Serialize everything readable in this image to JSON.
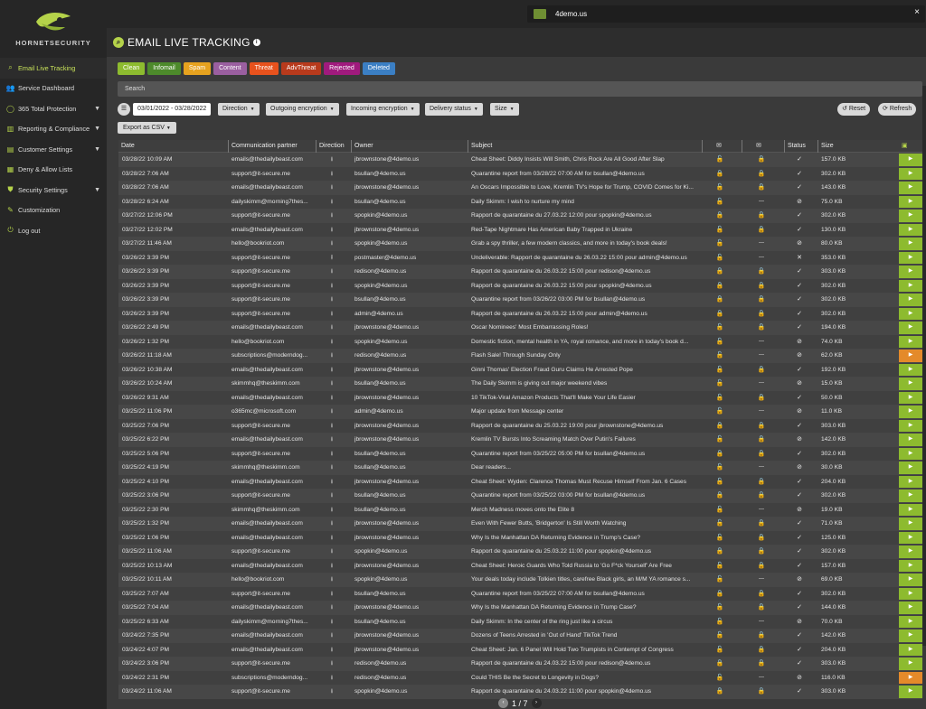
{
  "brand": {
    "name": "HORNETSECURITY"
  },
  "sidebar": {
    "items": [
      {
        "label": "Email Live Tracking",
        "icon": "magnifier-icon",
        "active": true,
        "chevron": false
      },
      {
        "label": "Service Dashboard",
        "icon": "users-icon",
        "active": false,
        "chevron": false
      },
      {
        "label": "365 Total Protection",
        "icon": "circle-icon",
        "active": false,
        "chevron": true
      },
      {
        "label": "Reporting & Compliance",
        "icon": "chart-icon",
        "active": false,
        "chevron": true
      },
      {
        "label": "Customer Settings",
        "icon": "card-icon",
        "active": false,
        "chevron": true
      },
      {
        "label": "Deny & Allow Lists",
        "icon": "list-icon",
        "active": false,
        "chevron": false
      },
      {
        "label": "Security Settings",
        "icon": "shield-icon",
        "active": false,
        "chevron": true
      },
      {
        "label": "Customization",
        "icon": "brush-icon",
        "active": false,
        "chevron": false
      },
      {
        "label": "Log out",
        "icon": "power-icon",
        "active": false,
        "chevron": false
      }
    ]
  },
  "topbar": {
    "tenant": "4demo.us",
    "close_label": "×"
  },
  "header": {
    "title": "EMAIL LIVE TRACKING",
    "info": "i"
  },
  "chips": [
    {
      "label": "Clean",
      "color": "#8dbb2f"
    },
    {
      "label": "Infomail",
      "color": "#4d8a2b"
    },
    {
      "label": "Spam",
      "color": "#e6a21f"
    },
    {
      "label": "Content",
      "color": "#9a5fa0"
    },
    {
      "label": "Threat",
      "color": "#e8521d"
    },
    {
      "label": "AdvThreat",
      "color": "#b83a1c"
    },
    {
      "label": "Rejected",
      "color": "#a01a7d"
    },
    {
      "label": "Deleted",
      "color": "#3b7fc4"
    }
  ],
  "search": {
    "placeholder": "Search"
  },
  "filters": {
    "date_range": "03/01/2022 - 03/28/2022",
    "direction": "Direction",
    "outgoing": "Outgoing encryption",
    "incoming": "Incoming encryption",
    "delivery": "Delivery status",
    "size": "Size",
    "reset": "Reset",
    "refresh": "Refresh",
    "export": "Export as CSV"
  },
  "table": {
    "columns": [
      "Date",
      "Communication partner",
      "Direction",
      "Owner",
      "Subject",
      "",
      "",
      "Status",
      "Size"
    ],
    "rows": [
      [
        "03/28/22 10:09 AM",
        "emails@thedailybeast.com",
        "in",
        "jbrownstone@4demo.us",
        "Cheat Sheet: Diddy Insists Will Smith, Chris Rock Are All Good After Slap",
        "open",
        "lock",
        "check",
        "157.0 KB",
        "green"
      ],
      [
        "03/28/22 7:06 AM",
        "support@it-secure.me",
        "in",
        "bsullan@4demo.us",
        "Quarantine report from 03/28/22 07:00 AM for bsullan@4demo.us",
        "lock",
        "lock",
        "check",
        "302.0 KB",
        "green"
      ],
      [
        "03/28/22 7:06 AM",
        "emails@thedailybeast.com",
        "in",
        "jbrownstone@4demo.us",
        "An Oscars Impossible to Love, Kremlin TV's Hope for Trump, COVID Comes for Ki...",
        "open",
        "lock",
        "check",
        "143.0 KB",
        "green"
      ],
      [
        "03/28/22 6:24 AM",
        "dailyskimm@morning7thes...",
        "in",
        "bsullan@4demo.us",
        "Daily Skimm: I wish to nurture my mind",
        "open",
        "dash",
        "ban",
        "75.0 KB",
        "green"
      ],
      [
        "03/27/22 12:06 PM",
        "support@it-secure.me",
        "in",
        "spopkin@4demo.us",
        "Rapport de quarantaine du 27.03.22 12:00 pour spopkin@4demo.us",
        "lock",
        "lock",
        "check",
        "302.0 KB",
        "green"
      ],
      [
        "03/27/22 12:02 PM",
        "emails@thedailybeast.com",
        "in",
        "jbrownstone@4demo.us",
        "Red-Tape Nightmare Has American Baby Trapped in Ukraine",
        "open",
        "lock",
        "check",
        "130.0 KB",
        "green"
      ],
      [
        "03/27/22 11:46 AM",
        "hello@bookriot.com",
        "in",
        "spopkin@4demo.us",
        "Grab a spy thriller, a few modern classics, and more in today's book deals!",
        "open",
        "dash",
        "ban",
        "80.0 KB",
        "green"
      ],
      [
        "03/26/22 3:39 PM",
        "support@it-secure.me",
        "out",
        "postmaster@4demo.us",
        "Undeliverable: Rapport de quarantaine du 26.03.22 15:00 pour admin@4demo.us",
        "open",
        "dash",
        "x",
        "353.0 KB",
        "green"
      ],
      [
        "03/26/22 3:39 PM",
        "support@it-secure.me",
        "in",
        "redison@4demo.us",
        "Rapport de quarantaine du 26.03.22 15:00 pour redison@4demo.us",
        "lock",
        "lock",
        "check",
        "303.0 KB",
        "green"
      ],
      [
        "03/26/22 3:39 PM",
        "support@it-secure.me",
        "in",
        "spopkin@4demo.us",
        "Rapport de quarantaine du 26.03.22 15:00 pour spopkin@4demo.us",
        "lock",
        "lock",
        "check",
        "302.0 KB",
        "green"
      ],
      [
        "03/26/22 3:39 PM",
        "support@it-secure.me",
        "in",
        "bsullan@4demo.us",
        "Quarantine report from 03/26/22 03:00 PM for bsullan@4demo.us",
        "lock",
        "lock",
        "check",
        "302.0 KB",
        "green"
      ],
      [
        "03/26/22 3:39 PM",
        "support@it-secure.me",
        "in",
        "admin@4demo.us",
        "Rapport de quarantaine du 26.03.22 15:00 pour admin@4demo.us",
        "lock",
        "lock",
        "check",
        "302.0 KB",
        "green"
      ],
      [
        "03/26/22 2:49 PM",
        "emails@thedailybeast.com",
        "in",
        "jbrownstone@4demo.us",
        "Oscar Nominees' Most Embarrassing Roles!",
        "open",
        "lock",
        "check",
        "194.0 KB",
        "green"
      ],
      [
        "03/26/22 1:32 PM",
        "hello@bookriot.com",
        "in",
        "spopkin@4demo.us",
        "Domestic fiction, mental health in YA, royal romance, and more in today's book d...",
        "open",
        "dash",
        "ban",
        "74.0 KB",
        "green"
      ],
      [
        "03/26/22 11:18 AM",
        "subscriptions@moderndog...",
        "in",
        "redison@4demo.us",
        "Flash Sale! Through Sunday Only",
        "open",
        "dash",
        "ban",
        "62.0 KB",
        "orange"
      ],
      [
        "03/26/22 10:38 AM",
        "emails@thedailybeast.com",
        "in",
        "jbrownstone@4demo.us",
        "Ginni Thomas' Election Fraud Guru Claims He Arrested Pope",
        "open",
        "lock",
        "check",
        "192.0 KB",
        "green"
      ],
      [
        "03/26/22 10:24 AM",
        "skimmhq@theskimm.com",
        "in",
        "bsullan@4demo.us",
        "The Daily Skimm is giving out major weekend vibes",
        "open",
        "dash",
        "ban",
        "15.0 KB",
        "green"
      ],
      [
        "03/26/22 9:31 AM",
        "emails@thedailybeast.com",
        "in",
        "jbrownstone@4demo.us",
        "10 TikTok-Viral Amazon Products That'll Make Your Life Easier",
        "open",
        "lock",
        "check",
        "50.0 KB",
        "green"
      ],
      [
        "03/25/22 11:06 PM",
        "o365mc@microsoft.com",
        "in",
        "admin@4demo.us",
        "Major update from Message center",
        "open",
        "dash",
        "ban",
        "11.0 KB",
        "green"
      ],
      [
        "03/25/22 7:06 PM",
        "support@it-secure.me",
        "in",
        "jbrownstone@4demo.us",
        "Rapport de quarantaine du 25.03.22 19:00 pour jbrownstone@4demo.us",
        "lock",
        "lock",
        "check",
        "303.0 KB",
        "green"
      ],
      [
        "03/25/22 6:22 PM",
        "emails@thedailybeast.com",
        "in",
        "jbrownstone@4demo.us",
        "Kremlin TV Bursts Into Screaming Match Over Putin's Failures",
        "open",
        "lock",
        "ban",
        "142.0 KB",
        "green"
      ],
      [
        "03/25/22 5:06 PM",
        "support@it-secure.me",
        "in",
        "bsullan@4demo.us",
        "Quarantine report from 03/25/22 05:00 PM for bsullan@4demo.us",
        "lock",
        "lock",
        "check",
        "302.0 KB",
        "green"
      ],
      [
        "03/25/22 4:19 PM",
        "skimmhq@theskimm.com",
        "in",
        "bsullan@4demo.us",
        "Dear readers...",
        "open",
        "dash",
        "ban",
        "30.0 KB",
        "green"
      ],
      [
        "03/25/22 4:10 PM",
        "emails@thedailybeast.com",
        "in",
        "jbrownstone@4demo.us",
        "Cheat Sheet: Wyden: Clarence Thomas Must Recuse Himself From Jan. 6 Cases",
        "open",
        "lock",
        "check",
        "204.0 KB",
        "green"
      ],
      [
        "03/25/22 3:06 PM",
        "support@it-secure.me",
        "in",
        "bsullan@4demo.us",
        "Quarantine report from 03/25/22 03:00 PM for bsullan@4demo.us",
        "lock",
        "lock",
        "check",
        "302.0 KB",
        "green"
      ],
      [
        "03/25/22 2:30 PM",
        "skimmhq@theskimm.com",
        "in",
        "bsullan@4demo.us",
        "Merch Madness moves onto the Elite 8",
        "open",
        "dash",
        "ban",
        "19.0 KB",
        "green"
      ],
      [
        "03/25/22 1:32 PM",
        "emails@thedailybeast.com",
        "in",
        "jbrownstone@4demo.us",
        "Even With Fewer Butts, 'Bridgerton' Is Still Worth Watching",
        "open",
        "lock",
        "check",
        "71.0 KB",
        "green"
      ],
      [
        "03/25/22 1:06 PM",
        "emails@thedailybeast.com",
        "in",
        "jbrownstone@4demo.us",
        "Why Is the Manhattan DA Returning Evidence in Trump's Case?",
        "open",
        "lock",
        "check",
        "125.0 KB",
        "green"
      ],
      [
        "03/25/22 11:06 AM",
        "support@it-secure.me",
        "in",
        "spopkin@4demo.us",
        "Rapport de quarantaine du 25.03.22 11:00 pour spopkin@4demo.us",
        "lock",
        "lock",
        "check",
        "302.0 KB",
        "green"
      ],
      [
        "03/25/22 10:13 AM",
        "emails@thedailybeast.com",
        "in",
        "jbrownstone@4demo.us",
        "Cheat Sheet: Heroic Guards Who Told Russia to 'Go F*ck Yourself' Are Free",
        "open",
        "lock",
        "check",
        "157.0 KB",
        "green"
      ],
      [
        "03/25/22 10:11 AM",
        "hello@bookriot.com",
        "in",
        "spopkin@4demo.us",
        "Your deals today include Tolkien titles, carefree Black girls, an M/M YA romance s...",
        "open",
        "dash",
        "ban",
        "69.0 KB",
        "green"
      ],
      [
        "03/25/22 7:07 AM",
        "support@it-secure.me",
        "in",
        "bsullan@4demo.us",
        "Quarantine report from 03/25/22 07:00 AM for bsullan@4demo.us",
        "lock",
        "lock",
        "check",
        "302.0 KB",
        "green"
      ],
      [
        "03/25/22 7:04 AM",
        "emails@thedailybeast.com",
        "in",
        "jbrownstone@4demo.us",
        "Why Is the Manhattan DA Returning Evidence in Trump Case?",
        "open",
        "lock",
        "check",
        "144.0 KB",
        "green"
      ],
      [
        "03/25/22 6:33 AM",
        "dailyskimm@morning7thes...",
        "in",
        "bsullan@4demo.us",
        "Daily Skimm: In the center of the ring just like a circus",
        "open",
        "dash",
        "ban",
        "70.0 KB",
        "green"
      ],
      [
        "03/24/22 7:35 PM",
        "emails@thedailybeast.com",
        "in",
        "jbrownstone@4demo.us",
        "Dozens of Teens Arrested in 'Out of Hand' TikTok Trend",
        "open",
        "lock",
        "check",
        "142.0 KB",
        "green"
      ],
      [
        "03/24/22 4:07 PM",
        "emails@thedailybeast.com",
        "in",
        "jbrownstone@4demo.us",
        "Cheat Sheet: Jan. 6 Panel Will Hold Two Trumpists in Contempt of Congress",
        "open",
        "lock",
        "check",
        "204.0 KB",
        "green"
      ],
      [
        "03/24/22 3:06 PM",
        "support@it-secure.me",
        "in",
        "redison@4demo.us",
        "Rapport de quarantaine du 24.03.22 15:00 pour redison@4demo.us",
        "lock",
        "lock",
        "check",
        "303.0 KB",
        "green"
      ],
      [
        "03/24/22 2:31 PM",
        "subscriptions@moderndog...",
        "in",
        "redison@4demo.us",
        "Could THIS Be the Secret to Longevity in Dogs?",
        "open",
        "dash",
        "ban",
        "116.0 KB",
        "orange"
      ],
      [
        "03/24/22 11:06 AM",
        "support@it-secure.me",
        "in",
        "spopkin@4demo.us",
        "Rapport de quarantaine du 24.03.22 11:00 pour spopkin@4demo.us",
        "lock",
        "lock",
        "check",
        "303.0 KB",
        "green"
      ]
    ]
  },
  "pager": {
    "text": "1 / 7"
  }
}
